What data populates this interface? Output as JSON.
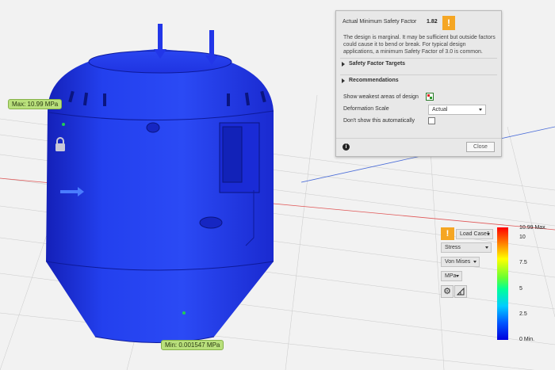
{
  "probes": {
    "max_label": "Max: 10.99 MPa",
    "min_label": "Min: 0.001547 MPa"
  },
  "icons": {
    "lock": "lock-icon",
    "arrow": "load-arrow-icon",
    "weak_areas": "weak-areas-icon",
    "settings": "gear-icon",
    "probe": "probe-icon",
    "info": "info-icon",
    "warning": "warning-icon"
  },
  "safety_panel": {
    "header_label": "Actual Minimum Safety Factor",
    "header_value": "1.82",
    "warning_glyph": "!",
    "description": "The design is marginal. It may be sufficient but outside factors could cause it to bend or break. For typical design applications, a minimum Safety Factor of 3.0 is common.",
    "section_targets": "Safety Factor Targets",
    "section_recommendations": "Recommendations",
    "show_weakest_label": "Show weakest areas of design",
    "deformation_label": "Deformation Scale",
    "deformation_value": "Actual",
    "dont_show_label": "Don't show this automatically",
    "dont_show_checked": false,
    "info_glyph": "i",
    "close_label": "Close"
  },
  "legend": {
    "warning_glyph": "!",
    "load_case": "Load Case1",
    "result_type": "Stress",
    "component": "Von Mises",
    "units": "MPa",
    "scale_labels": {
      "max": "10.99 Max.",
      "t10": "10",
      "t75": "7.5",
      "t5": "5",
      "t25": "2.5",
      "min": "0 Min."
    }
  },
  "colors": {
    "body_blue": "#1c2ee0",
    "accent_warning": "#f5a623",
    "probe_green": "#b9e07c",
    "grid_red": "#e05555",
    "grid_blue": "#4a6cd8"
  }
}
